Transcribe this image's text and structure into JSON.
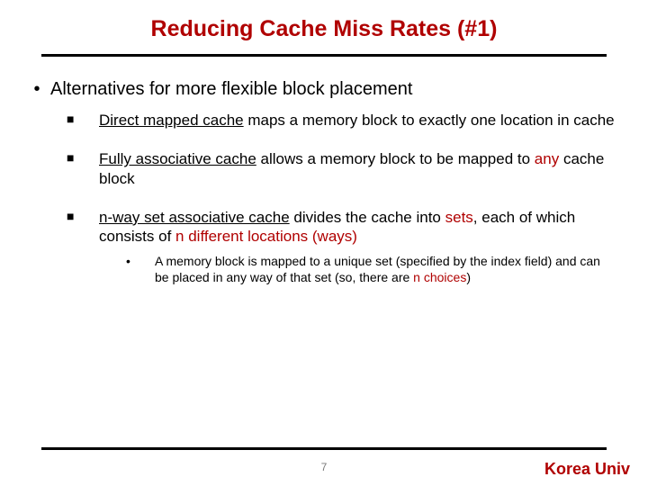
{
  "title": {
    "w1": "Reducing",
    "w2": "Cache",
    "w3": "Miss",
    "w4": "Rates",
    "w5": "(#1)"
  },
  "content": {
    "p0": "Alternatives for more flexible block placement",
    "i1": {
      "a": "Direct mapped cache",
      "b": " maps a memory block to exactly one location in cache"
    },
    "i2": {
      "a": "Fully associative cache",
      "b": " allows a memory block to be mapped to ",
      "c": "any",
      "d": " cache block"
    },
    "i3": {
      "a": "n-way set associative cache",
      "b": " divides the cache into ",
      "c": "sets",
      "d": ", each of which consists of ",
      "e": "n different locations (ways)"
    },
    "sub": {
      "a": "A memory block is mapped to a unique set (specified by the index field) and can be placed in any way of that set (so, there are ",
      "b": "n choices",
      "c": ")"
    }
  },
  "page": "7",
  "brand": "Korea Univ",
  "glyph": {
    "disc": "•",
    "square": "■"
  }
}
